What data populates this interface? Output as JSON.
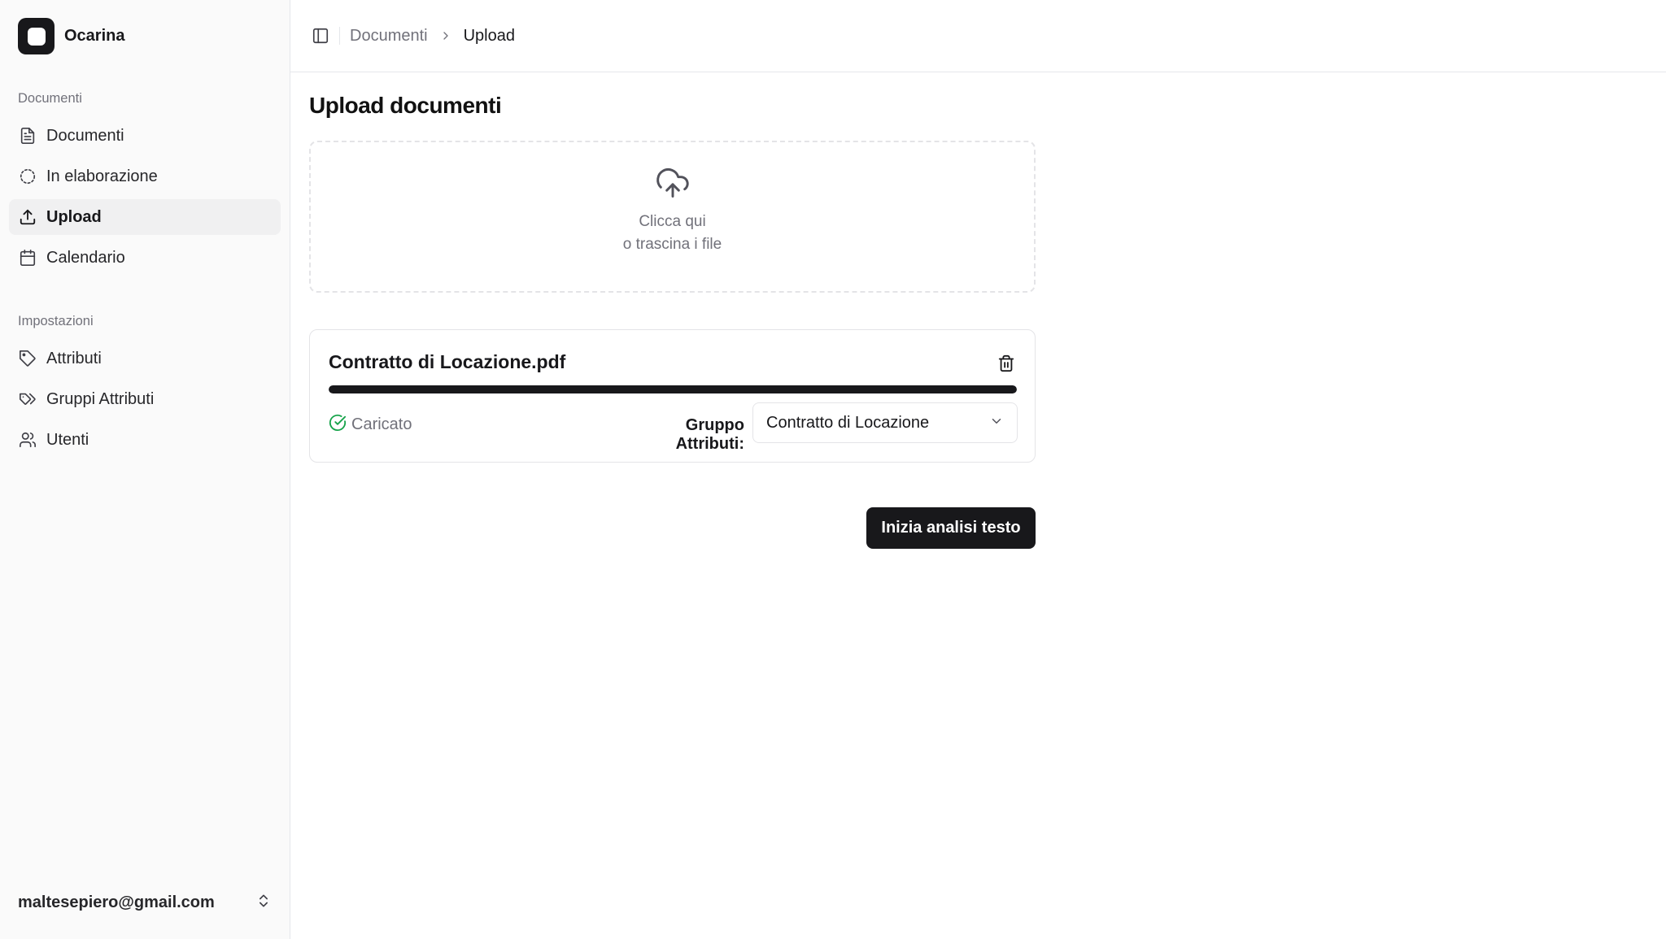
{
  "app": {
    "name": "Ocarina"
  },
  "sidebar": {
    "groups": [
      {
        "label": "Documenti",
        "items": [
          {
            "label": "Documenti",
            "icon": "file-text-icon"
          },
          {
            "label": "In elaborazione",
            "icon": "loader-circle-icon"
          },
          {
            "label": "Upload",
            "icon": "upload-icon",
            "active": true
          },
          {
            "label": "Calendario",
            "icon": "calendar-icon"
          }
        ]
      },
      {
        "label": "Impostazioni",
        "items": [
          {
            "label": "Attributi",
            "icon": "tag-icon"
          },
          {
            "label": "Gruppi Attributi",
            "icon": "tags-icon"
          },
          {
            "label": "Utenti",
            "icon": "users-icon"
          }
        ]
      }
    ],
    "user": {
      "email": "maltesepiero@gmail.com",
      "icon": "chevrons-up-down-icon"
    }
  },
  "header": {
    "breadcrumb": [
      {
        "label": "Documenti"
      },
      {
        "label": "Upload"
      }
    ]
  },
  "page": {
    "title": "Upload documenti",
    "dropzone": {
      "line1": "Clicca qui",
      "line2": "o trascina i file"
    },
    "file": {
      "name": "Contratto di Locazione.pdf",
      "progress": 1.0,
      "status": "Caricato",
      "group_label": "Gruppo Attributi:",
      "group_value": "Contratto di Locazione"
    },
    "submit_label": "Inizia analisi testo"
  },
  "colors": {
    "accent": "#18181b",
    "success": "#16a34a",
    "muted": "#71717a",
    "sidebar_bg": "#fafafa"
  }
}
